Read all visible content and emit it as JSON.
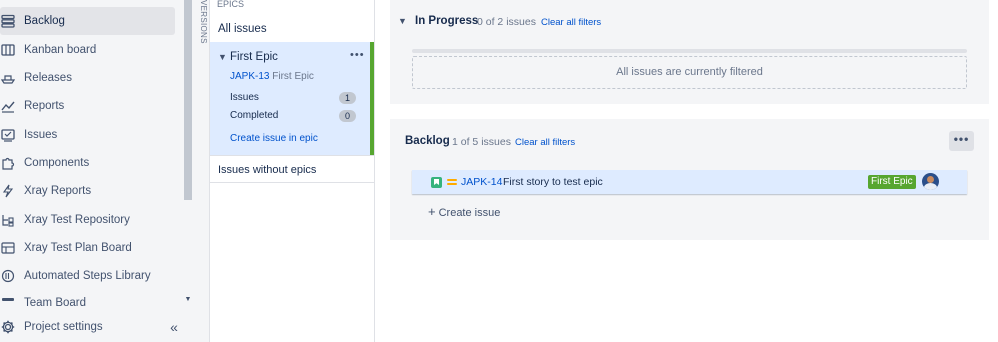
{
  "sidebar": {
    "items": [
      {
        "label": "Backlog",
        "icon": "backlog-icon",
        "active": true
      },
      {
        "label": "Kanban board",
        "icon": "board-icon"
      },
      {
        "label": "Releases",
        "icon": "ship-icon"
      },
      {
        "label": "Reports",
        "icon": "chart-icon"
      },
      {
        "label": "Issues",
        "icon": "issues-icon"
      },
      {
        "label": "Components",
        "icon": "puzzle-icon"
      },
      {
        "label": "Xray Reports",
        "icon": "lightning-icon"
      },
      {
        "label": "Xray Test Repository",
        "icon": "repository-icon"
      },
      {
        "label": "Xray Test Plan Board",
        "icon": "plan-board-icon"
      },
      {
        "label": "Automated Steps Library",
        "icon": "library-icon"
      },
      {
        "label": "Team Board",
        "icon": "team-board-icon"
      }
    ],
    "project_settings": "Project settings",
    "collapse_icon": "double-chevron-left-icon"
  },
  "versions": {
    "label": "VERSIONS"
  },
  "epics": {
    "title": "EPICS",
    "all_issues": "All issues",
    "epic": {
      "name": "First Epic",
      "key": "JAPK-13",
      "key_name": "First Epic",
      "issues_label": "Issues",
      "issues_count": "1",
      "completed_label": "Completed",
      "completed_count": "0",
      "create_link": "Create issue in epic",
      "color": "#57a630"
    },
    "without_epics": "Issues without epics"
  },
  "sprint": {
    "name": "In Progress",
    "count": "0 of 2 issues",
    "clear_filters": "Clear all filters",
    "empty_message": "All issues are currently filtered"
  },
  "backlog": {
    "name": "Backlog",
    "count": "1 of 5 issues",
    "clear_filters": "Clear all filters",
    "more": "•••",
    "issues": [
      {
        "key": "JAPK-14",
        "summary": "First story to test epic",
        "epic": "First Epic",
        "type_icon": "story-icon",
        "priority_icon": "priority-medium-icon"
      }
    ],
    "create_issue": "Create issue"
  },
  "colors": {
    "accent": "#0052cc",
    "selected": "#deebff",
    "epic_green": "#57a630"
  }
}
